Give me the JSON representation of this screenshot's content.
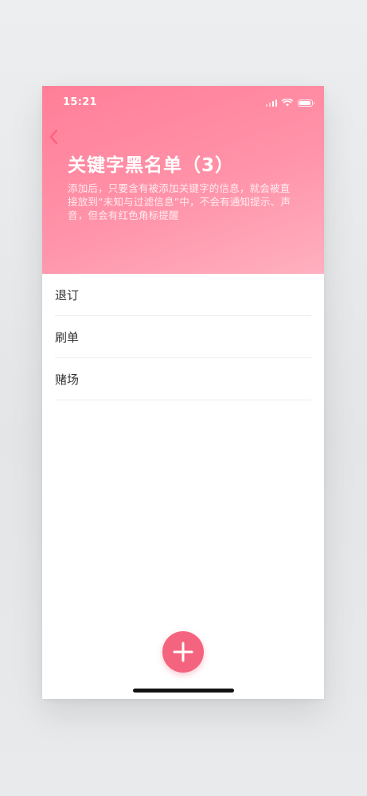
{
  "status_bar": {
    "time": "15:21",
    "battery_level": 0.9
  },
  "header": {
    "back_icon": "chevron-left-icon",
    "title": "关键字黑名单（3）",
    "description": "添加后，只要含有被添加关键字的信息，就会被直接放到“未知与过滤信息”中，不会有通知提示、声音，但会有红色角标提醒"
  },
  "keywords": [
    {
      "label": "退订"
    },
    {
      "label": "刷单"
    },
    {
      "label": "赌场"
    }
  ],
  "fab": {
    "icon": "plus-icon",
    "color": "#f4647e"
  },
  "colors": {
    "header_gradient_start": "#ff7e98",
    "header_gradient_end": "#ffb0c0",
    "accent": "#f4647e"
  }
}
